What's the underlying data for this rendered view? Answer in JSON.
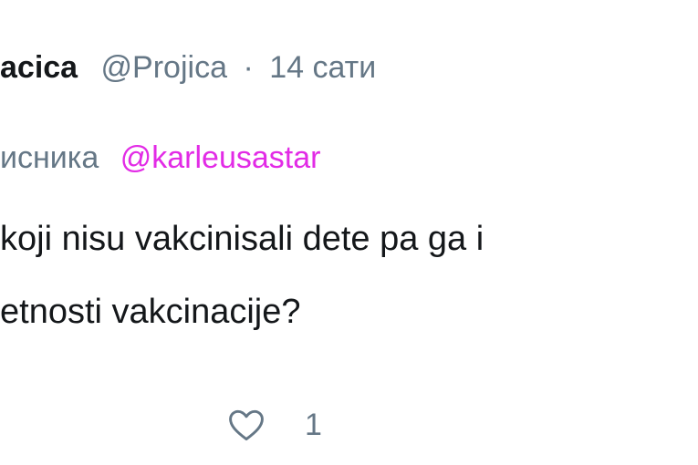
{
  "tweet": {
    "name": "acica",
    "handle": "@Projica",
    "separator": "·",
    "time": "14 сати",
    "reply_prefix": "исника",
    "reply_mention": "@karleusastar",
    "text_line1": "koji nisu vakcinisali dete pa ga i",
    "text_line2": "etnosti vakcinacije?",
    "like_count": "1"
  },
  "icons": {
    "like": "heart-outline-icon"
  },
  "colors": {
    "mention": "#e22be6",
    "secondary": "#657786",
    "primary": "#14171a"
  }
}
